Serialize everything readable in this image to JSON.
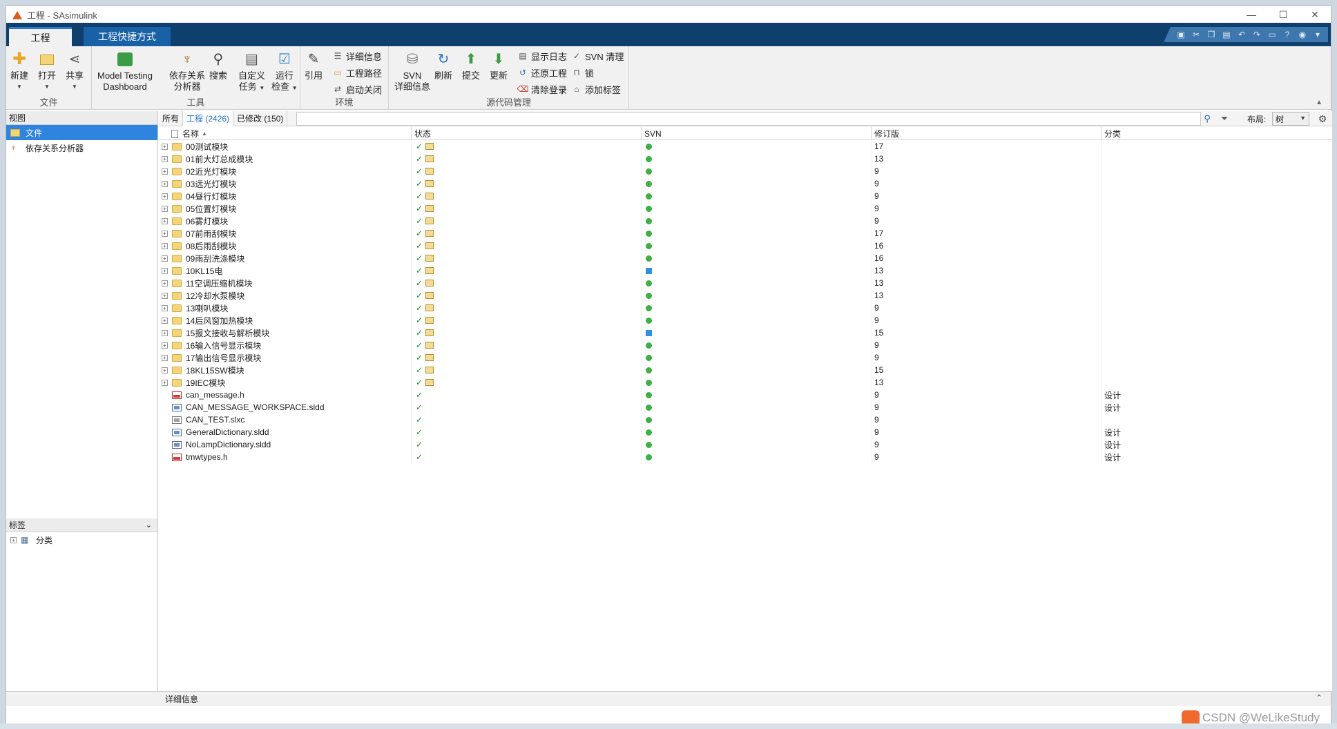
{
  "window": {
    "title": "工程 - SAsimulink",
    "controls": [
      "—",
      "☐",
      "✕"
    ]
  },
  "ribbon_tabs": [
    {
      "label": "工程"
    },
    {
      "label": "工程快捷方式"
    }
  ],
  "ribbon": {
    "file": {
      "group_label": "文件",
      "new_label": "新建",
      "open_label": "打开",
      "share_label": "共享"
    },
    "tools": {
      "group_label": "工具",
      "mtd_line1": "Model Testing",
      "mtd_line2": "Dashboard",
      "dep_line1": "依存关系",
      "dep_line2": "分析器",
      "search_label": "搜索",
      "custom_line1": "自定义",
      "custom_line2": "任务",
      "run_line1": "运行",
      "run_line2": "检查"
    },
    "env": {
      "group_label": "环境",
      "ref_label": "引用",
      "details_label": "详细信息",
      "path_label": "工程路径",
      "startup_label": "启动关闭"
    },
    "scm": {
      "group_label": "源代码管理",
      "svn_line1": "SVN",
      "svn_line2": "详细信息",
      "refresh_label": "刷新",
      "commit_label": "提交",
      "update_label": "更新",
      "log_label": "显示日志",
      "revert_label": "还原工程",
      "clear_login_label": "清除登录",
      "svn_cleanup_label": "SVN 清理",
      "lock_label": "锁",
      "add_tag_label": "添加标签"
    }
  },
  "left": {
    "views_header": "视图",
    "views": [
      {
        "label": "文件"
      },
      {
        "label": "依存关系分析器"
      }
    ],
    "labels_header": "标签",
    "labels_tree": "分类"
  },
  "filter_tabs": [
    {
      "label": "所有"
    },
    {
      "label": "工程 (2426)"
    },
    {
      "label": "已修改 (150)"
    }
  ],
  "layout": {
    "label": "布局:",
    "value": "树"
  },
  "columns": {
    "name": "名称",
    "status": "状态",
    "svn": "SVN",
    "revision": "修订版",
    "category": "分类"
  },
  "rows": [
    {
      "name": "00测试模块",
      "type": "folder",
      "svn": "green",
      "rev": "17",
      "cat": ""
    },
    {
      "name": "01前大灯总成模块",
      "type": "folder",
      "svn": "green",
      "rev": "13",
      "cat": ""
    },
    {
      "name": "02近光灯模块",
      "type": "folder",
      "svn": "green",
      "rev": "9",
      "cat": ""
    },
    {
      "name": "03远光灯模块",
      "type": "folder",
      "svn": "green",
      "rev": "9",
      "cat": ""
    },
    {
      "name": "04昼行灯模块",
      "type": "folder",
      "svn": "green",
      "rev": "9",
      "cat": ""
    },
    {
      "name": "05位置灯模块",
      "type": "folder",
      "svn": "green",
      "rev": "9",
      "cat": ""
    },
    {
      "name": "06雾灯模块",
      "type": "folder",
      "svn": "green",
      "rev": "9",
      "cat": ""
    },
    {
      "name": "07前雨刮模块",
      "type": "folder",
      "svn": "green",
      "rev": "17",
      "cat": ""
    },
    {
      "name": "08后雨刮模块",
      "type": "folder",
      "svn": "green",
      "rev": "16",
      "cat": ""
    },
    {
      "name": "09雨刮洗涤模块",
      "type": "folder",
      "svn": "green",
      "rev": "16",
      "cat": ""
    },
    {
      "name": "10KL15电",
      "type": "folder",
      "svn": "blue",
      "rev": "13",
      "cat": ""
    },
    {
      "name": "11空调压缩机模块",
      "type": "folder",
      "svn": "green",
      "rev": "13",
      "cat": ""
    },
    {
      "name": "12冷却水泵模块",
      "type": "folder",
      "svn": "green",
      "rev": "13",
      "cat": ""
    },
    {
      "name": "13喇叭模块",
      "type": "folder",
      "svn": "green",
      "rev": "9",
      "cat": ""
    },
    {
      "name": "14后风窗加热模块",
      "type": "folder",
      "svn": "green",
      "rev": "9",
      "cat": ""
    },
    {
      "name": "15报文接收与解析模块",
      "type": "folder",
      "svn": "blue",
      "rev": "15",
      "cat": ""
    },
    {
      "name": "16输入信号显示模块",
      "type": "folder",
      "svn": "green",
      "rev": "9",
      "cat": ""
    },
    {
      "name": "17输出信号显示模块",
      "type": "folder",
      "svn": "green",
      "rev": "9",
      "cat": ""
    },
    {
      "name": "18KL15SW模块",
      "type": "folder",
      "svn": "green",
      "rev": "15",
      "cat": ""
    },
    {
      "name": "19IEC模块",
      "type": "folder",
      "svn": "green",
      "rev": "13",
      "cat": ""
    },
    {
      "name": "can_message.h",
      "type": "h",
      "svn": "green",
      "rev": "9",
      "cat": "设计"
    },
    {
      "name": "CAN_MESSAGE_WORKSPACE.sldd",
      "type": "sldd",
      "svn": "green",
      "rev": "9",
      "cat": "设计"
    },
    {
      "name": "CAN_TEST.slxc",
      "type": "slx",
      "svn": "green",
      "rev": "9",
      "cat": ""
    },
    {
      "name": "GeneralDictionary.sldd",
      "type": "sldd",
      "svn": "green",
      "rev": "9",
      "cat": "设计"
    },
    {
      "name": "NoLampDictionary.sldd",
      "type": "sldd",
      "svn": "green",
      "rev": "9",
      "cat": "设计"
    },
    {
      "name": "tmwtypes.h",
      "type": "h",
      "svn": "green",
      "rev": "9",
      "cat": "设计"
    }
  ],
  "details_label": "详细信息",
  "watermark": "CSDN @WeLikeStudy",
  "colors": {
    "ribbon_tab_bar": "#0e3f6d",
    "selection": "#2f84df",
    "svn_ok": "#3cb043",
    "svn_modified": "#2f8fe6"
  }
}
